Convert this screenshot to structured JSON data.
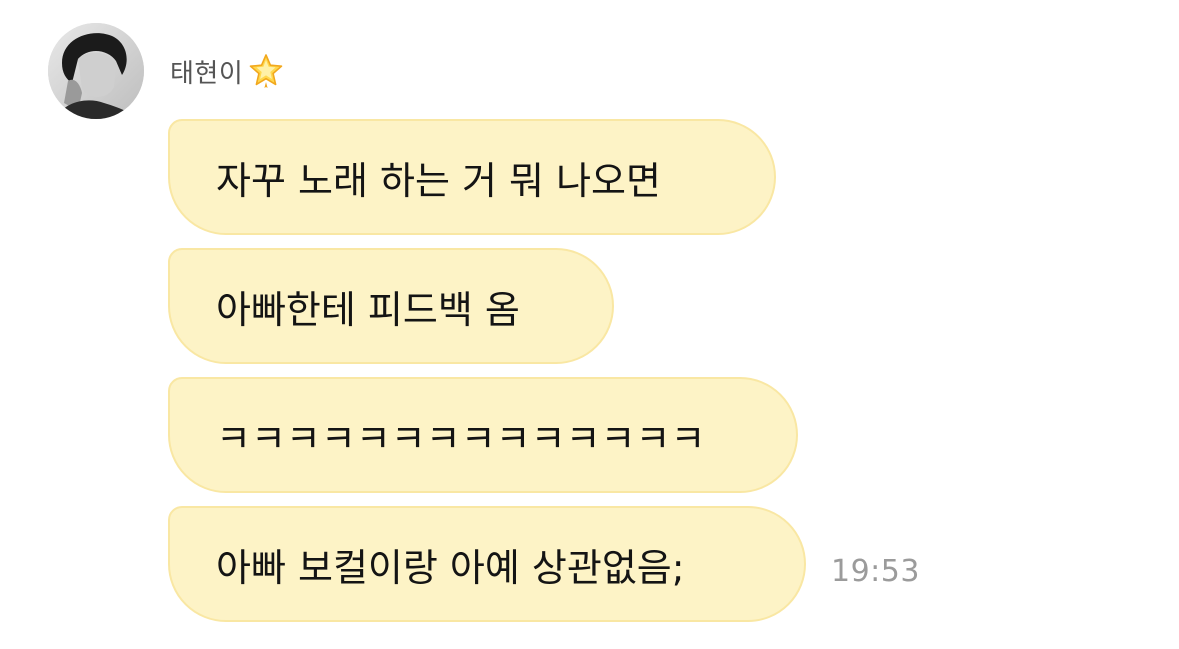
{
  "sender": {
    "name": "태현이",
    "badge_icon": "star-icon"
  },
  "messages": [
    {
      "text": "자꾸 노래 하는 거 뭐 나오면"
    },
    {
      "text": "아빠한테 피드백 옴"
    },
    {
      "text": "ㅋㅋㅋㅋㅋㅋㅋㅋㅋㅋㅋㅋㅋㅋ"
    },
    {
      "text": "아빠 보컬이랑 아예 상관없음;"
    }
  ],
  "timestamp": "19:53",
  "colors": {
    "bubble_fill": "#fdf3c6",
    "bubble_border": "#f9e7a3",
    "timestamp": "#9b9b9b"
  }
}
